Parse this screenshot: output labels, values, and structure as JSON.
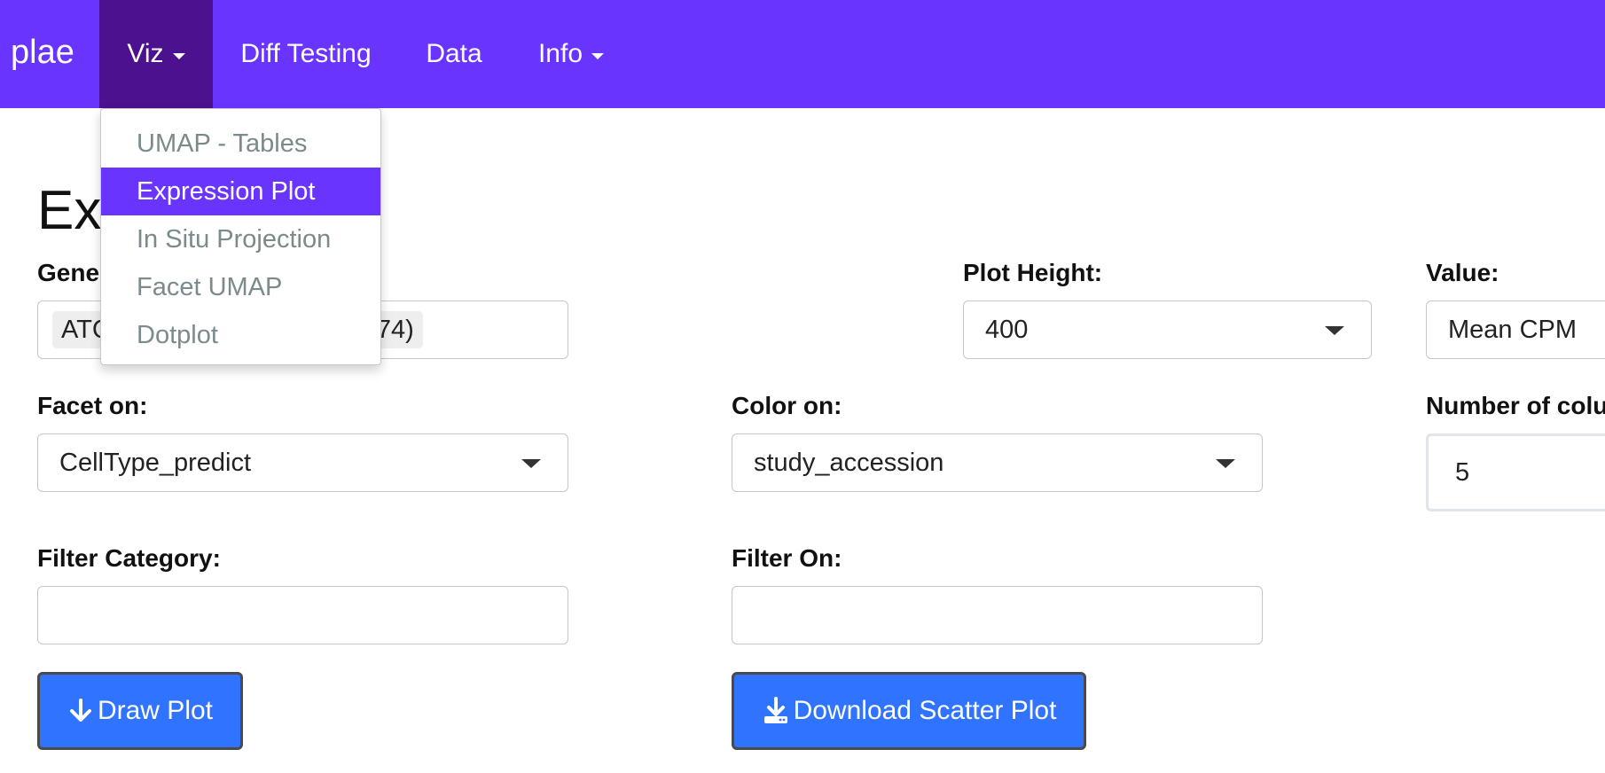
{
  "navbar": {
    "brand": "plae",
    "items": [
      {
        "label": "Viz"
      },
      {
        "label": "Diff Testing"
      },
      {
        "label": "Data"
      },
      {
        "label": "Info"
      }
    ]
  },
  "dropdown": {
    "items": [
      {
        "label": "UMAP - Tables"
      },
      {
        "label": "Expression Plot"
      },
      {
        "label": "In Situ Projection"
      },
      {
        "label": "Facet UMAP"
      },
      {
        "label": "Dotplot"
      }
    ],
    "selected": "Expression Plot"
  },
  "page": {
    "title_visible": "Exp"
  },
  "form": {
    "gene_label_visible": "Gene",
    "gene_chip_left": "ATC",
    "gene_chip_right": "74)",
    "plot_height_label": "Plot Height:",
    "plot_height_value": "400",
    "value_label": "Value:",
    "value_value": "Mean CPM",
    "facet_label": "Facet on:",
    "facet_value": "CellType_predict",
    "color_label": "Color on:",
    "color_value": "study_accession",
    "ncol_label_visible": "Number of colu",
    "ncol_value": "5",
    "filter_category_label": "Filter Category:",
    "filter_category_value": "",
    "filter_on_label": "Filter On:",
    "filter_on_value": ""
  },
  "buttons": {
    "draw_label": "Draw Plot",
    "download_label": "Download Scatter Plot"
  },
  "colors": {
    "navbar": "#6a34ff",
    "navbar_active": "#4b118f",
    "button": "#2f73ff",
    "dropdown_muted_text": "#7b8a8b"
  },
  "icons": {
    "draw": "arrow-down-icon",
    "download": "download-icon"
  }
}
